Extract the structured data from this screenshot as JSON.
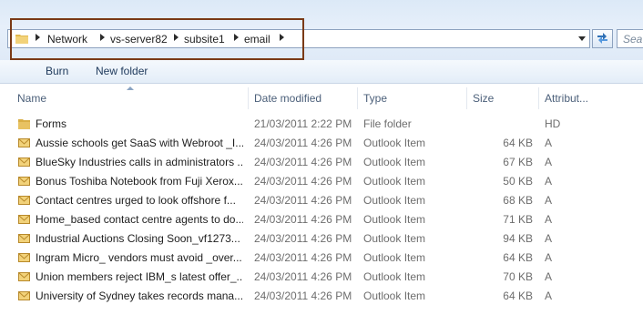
{
  "address": {
    "crumbs": [
      "Network",
      "vs-server82",
      "subsite1",
      "email"
    ],
    "search_placeholder": "Sea"
  },
  "toolbar": {
    "burn_label": "Burn",
    "new_folder_label": "New folder"
  },
  "columns": {
    "name": "Name",
    "date_modified": "Date modified",
    "type": "Type",
    "size": "Size",
    "attributes": "Attribut..."
  },
  "files": [
    {
      "name": "Forms",
      "date": "21/03/2011 2:22 PM",
      "type": "File folder",
      "size": "",
      "attr": "HD",
      "icon": "folder-icon"
    },
    {
      "name": "Aussie schools get SaaS with Webroot _I...",
      "date": "24/03/2011 4:26 PM",
      "type": "Outlook Item",
      "size": "64 KB",
      "attr": "A",
      "icon": "mail-icon"
    },
    {
      "name": "BlueSky Industries calls in administrators ...",
      "date": "24/03/2011 4:26 PM",
      "type": "Outlook Item",
      "size": "67 KB",
      "attr": "A",
      "icon": "mail-icon"
    },
    {
      "name": "Bonus Toshiba Notebook from Fuji Xerox...",
      "date": "24/03/2011 4:26 PM",
      "type": "Outlook Item",
      "size": "50 KB",
      "attr": "A",
      "icon": "mail-icon"
    },
    {
      "name": "Contact centres urged to look offshore f...",
      "date": "24/03/2011 4:26 PM",
      "type": "Outlook Item",
      "size": "68 KB",
      "attr": "A",
      "icon": "mail-icon"
    },
    {
      "name": "Home_based contact centre agents to do...",
      "date": "24/03/2011 4:26 PM",
      "type": "Outlook Item",
      "size": "71 KB",
      "attr": "A",
      "icon": "mail-icon"
    },
    {
      "name": "Industrial Auctions Closing Soon_vf1273...",
      "date": "24/03/2011 4:26 PM",
      "type": "Outlook Item",
      "size": "94 KB",
      "attr": "A",
      "icon": "mail-icon"
    },
    {
      "name": "Ingram Micro_ vendors must avoid _over...",
      "date": "24/03/2011 4:26 PM",
      "type": "Outlook Item",
      "size": "64 KB",
      "attr": "A",
      "icon": "mail-icon"
    },
    {
      "name": "Union members reject IBM_s latest offer_...",
      "date": "24/03/2011 4:26 PM",
      "type": "Outlook Item",
      "size": "70 KB",
      "attr": "A",
      "icon": "mail-icon"
    },
    {
      "name": "University of Sydney takes records mana...",
      "date": "24/03/2011 4:26 PM",
      "type": "Outlook Item",
      "size": "64 KB",
      "attr": "A",
      "icon": "mail-icon"
    }
  ],
  "colors": {
    "highlight_box": "#7a3a16",
    "folder": "#e8c262",
    "envelope": "#f2d27a"
  }
}
